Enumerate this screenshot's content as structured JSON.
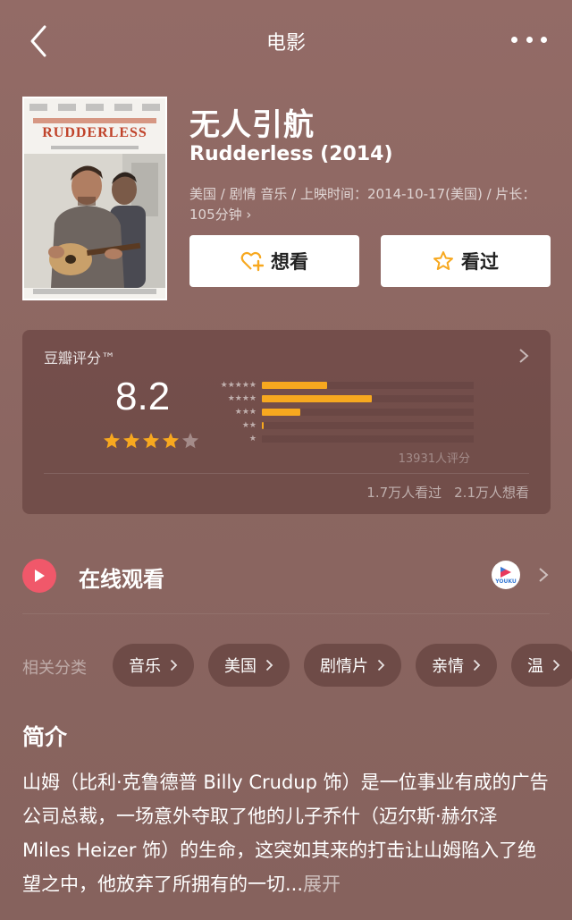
{
  "header": {
    "title": "电影",
    "back_icon": "chevron-left-icon",
    "more_icon": "more-dots-icon"
  },
  "poster": {
    "title": "RUDDERLESS"
  },
  "movie": {
    "title_cn": "无人引航",
    "title_en": "Rudderless (2014)",
    "meta": "美国 / 剧情 音乐 / 上映时间：2014-10-17(美国) / 片长：105分钟 ›"
  },
  "actions": {
    "want_label": "想看",
    "seen_label": "看过"
  },
  "rating": {
    "label": "豆瓣评分™",
    "score": "8.2",
    "stars": 4,
    "distribution": [
      {
        "stars": 5,
        "fraction": 0.31
      },
      {
        "stars": 4,
        "fraction": 0.52
      },
      {
        "stars": 3,
        "fraction": 0.18
      },
      {
        "stars": 2,
        "fraction": 0.01
      },
      {
        "stars": 1,
        "fraction": 0.0
      }
    ],
    "count": "13931人评分",
    "watched": "1.7万人看过",
    "wanted": "2.1万人想看"
  },
  "watch": {
    "label": "在线观看",
    "provider": "YOUKU"
  },
  "categories": {
    "label": "相关分类",
    "items": [
      "音乐",
      "美国",
      "剧情片",
      "亲情",
      "温"
    ]
  },
  "synopsis": {
    "title": "简介",
    "text": "山姆（比利·克鲁德普 Billy Crudup 饰）是一位事业有成的广告公司总裁，一场意外夺取了他的儿子乔什（迈尔斯·赫尔泽 Miles Heizer 饰）的生命，这突如其来的打击让山姆陷入了绝望之中，他放弃了所拥有的一切...",
    "expand": "展开"
  },
  "colors": {
    "accent": "#f7a81f",
    "play": "#f0586a",
    "background": "#8b6661"
  }
}
